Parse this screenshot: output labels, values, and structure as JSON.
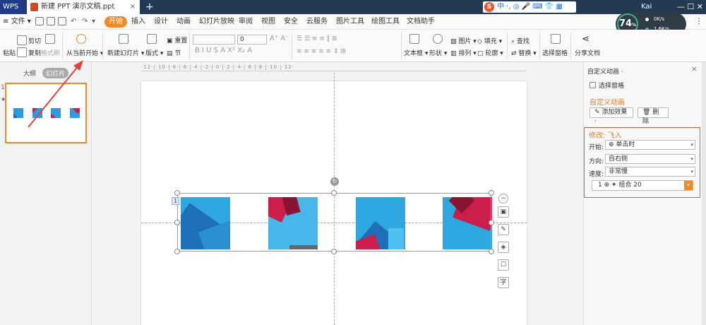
{
  "titlebar": {
    "app_name": "WPS",
    "doc_tab": "新建 PPT 演示文稿.ppt",
    "close": "×",
    "new_tab": "+",
    "ime_text": "中 ·, ◎ 🎤 ⌨ 👕 ▦",
    "user": "Kai",
    "window_controls": "— ☐ ✕"
  },
  "menu": {
    "file": "文件",
    "items": [
      "开始",
      "插入",
      "设计",
      "动画",
      "幻灯片放映",
      "审阅",
      "视图",
      "安全",
      "云服务",
      "图片工具",
      "绘图工具",
      "文档助手"
    ],
    "help": "?",
    "more": "⋮"
  },
  "ribbon": {
    "paste": "粘贴",
    "cut": "剪切",
    "copy": "复制",
    "format_painter": "格式刷",
    "from_current": "从当前开始",
    "new_slide": "新建幻灯片",
    "layout": "版式",
    "reset": "重置",
    "section": "节",
    "font_size": "0",
    "format_buttons": "B  I  U  S  A  X²  X₂  A",
    "textbox": "文本框",
    "shape": "形状",
    "picture": "图片",
    "arrange": "排列",
    "fill": "填充",
    "outline": "轮廓",
    "find": "查找",
    "replace": "替换",
    "select_pane": "选择窗格",
    "share_doc": "分享文档"
  },
  "gauge": {
    "value": "74",
    "unit": "%",
    "up": "0K/s",
    "down": "1.6K/s"
  },
  "leftpane": {
    "tab_outline": "大纲",
    "tab_slides": "幻灯片",
    "slide_number": "1",
    "star": "★"
  },
  "ruler": "·12·|·10·|·8·|·6·|·4·|·2·|·0·|·2·|·4·|·6·|·8·|·10·|·12·",
  "slide": {
    "anim_badge": "1",
    "rotate_glyph": "↻"
  },
  "floating_tools": [
    "−",
    "▣",
    "✎",
    "◈",
    "☐",
    "字"
  ],
  "rightpane": {
    "title": "自定义动画 ·",
    "close": "×",
    "select_pane": "选择窗格",
    "section": "自定义动画",
    "add_effect": "✎ 添加效果 ·",
    "delete": "🗑 删除",
    "modify": "修改: 飞入",
    "start_label": "开始:",
    "start_value": "单击时",
    "direction_label": "方向:",
    "direction_value": "自右侧",
    "speed_label": "速度:",
    "speed_value": "非常慢",
    "list_item": "1  ⊕  ✶  组合 20",
    "dropdown": "▾"
  },
  "colors": {
    "accent": "#f08a24",
    "title_bar": "#243a52",
    "image_blue": "#2ea7e0",
    "image_red": "#cc1e4a",
    "highlight_box": "#e05a4a"
  }
}
